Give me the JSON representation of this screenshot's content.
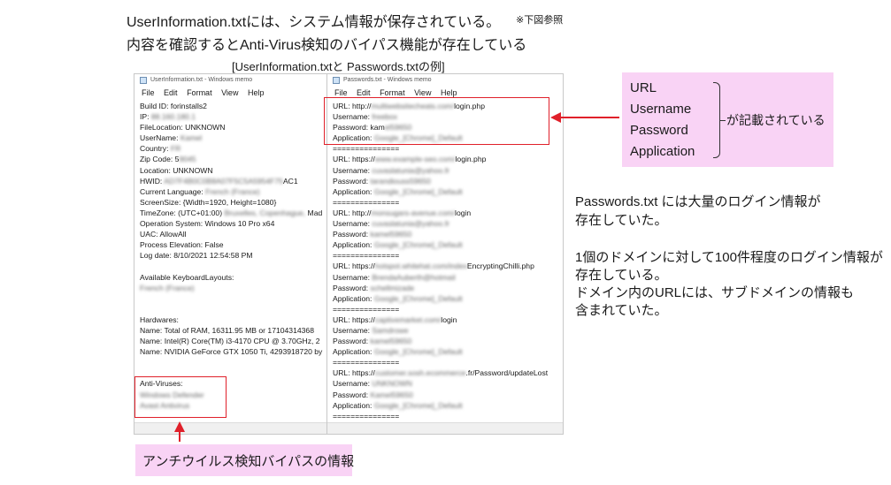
{
  "header": {
    "line1": "UserInformation.txtには、システム情報が保存されている。",
    "line2": "内容を確認するとAnti-Virus検知のバイパス機能が存在している",
    "ref_note": "※下図参照",
    "example_caption": "[UserInformation.txtと Passwords.txtの例]"
  },
  "notepad_left": {
    "title": "UserInformation.txt - Windows memo",
    "menu": [
      "File",
      "Edit",
      "Format",
      "View",
      "Help"
    ],
    "lines": [
      {
        "text": "Build ID: forinstalls2"
      },
      {
        "text": "IP: ",
        "blurred": "88.160.180.1"
      },
      {
        "text": "FileLocation: UNKNOWN"
      },
      {
        "text": "UserName: ",
        "blurred": "Kamel"
      },
      {
        "text": "Country: ",
        "blurred": "FR"
      },
      {
        "text": "Zip Code: 5",
        "blurred": "9045"
      },
      {
        "text": "Location: UNKNOWN"
      },
      {
        "text": "HWID: ",
        "blurred": "AD7F4B0C0B8A07F5C5A5954F75",
        "suffix": "AC1"
      },
      {
        "text": "Current Language: ",
        "blurred": "French (France)"
      },
      {
        "text": "ScreenSize: {Width=1920, Height=1080}"
      },
      {
        "text": "TimeZone: (UTC+01:00) ",
        "blurred": "Bruxelles, Copenhague,",
        "suffix": " Mad"
      },
      {
        "text": "Operation System: Windows 10 Pro x64"
      },
      {
        "text": "UAC: AllowAll"
      },
      {
        "text": "Process Elevation: False"
      },
      {
        "text": "Log date: 8/10/2021 12:54:58 PM"
      },
      {
        "text": ""
      },
      {
        "text": "Available KeyboardLayouts:"
      },
      {
        "text": "",
        "blurred": "French (France)"
      },
      {
        "text": ""
      },
      {
        "text": ""
      },
      {
        "text": "Hardwares:"
      },
      {
        "text": "Name: Total of RAM, 16311.95 MB or 17104314368"
      },
      {
        "text": "Name: Intel(R) Core(TM) i3-4170 CPU @ 3.70GHz, 2"
      },
      {
        "text": "Name: NVIDIA GeForce GTX 1050 Ti, 4293918720 by"
      },
      {
        "text": ""
      },
      {
        "text": ""
      },
      {
        "text": "Anti-Viruses:"
      },
      {
        "text": "",
        "blurred": "Windows Defender"
      },
      {
        "text": "",
        "blurred": "Avast Antivirus"
      }
    ]
  },
  "notepad_right": {
    "title": "Passwords.txt - Windows memo",
    "menu": [
      "File",
      "Edit",
      "Format",
      "View",
      "Help"
    ],
    "lines": [
      {
        "text": "URL: http://",
        "blurred": "multiwebsitecheats.com/",
        "suffix": "login.php"
      },
      {
        "text": "Username: ",
        "blurred": "freebox"
      },
      {
        "text": "Password: kam",
        "blurred": "el59650"
      },
      {
        "text": "Application: ",
        "blurred": "Google_[Chrome]_Default"
      },
      {
        "text": "==============="
      },
      {
        "text": "URL: https://",
        "blurred": "www.example-seo.com/",
        "suffix": "login.php"
      },
      {
        "text": "Username: ",
        "blurred": "cuvaslatunia@yahoo.fr"
      },
      {
        "text": "Password: ",
        "blurred": "tarandiouss59650"
      },
      {
        "text": "Application: ",
        "blurred": "Google_[Chrome]_Default"
      },
      {
        "text": "==============="
      },
      {
        "text": "URL: http://",
        "blurred": "monsugars-avenue.com/",
        "suffix": "login"
      },
      {
        "text": "Username: ",
        "blurred": "cuvaslatunia@yahoo.fr"
      },
      {
        "text": "Password: ",
        "blurred": "kamel59650"
      },
      {
        "text": "Application: ",
        "blurred": "Google_[Chrome]_Default"
      },
      {
        "text": "==============="
      },
      {
        "text": "URL: https://",
        "blurred": "hotspot.whitehat.com/index",
        "suffix": "EncryptingChilli.php"
      },
      {
        "text": "Username: ",
        "blurred": "BrendaAuberth@hotmail"
      },
      {
        "text": "Password: ",
        "blurred": "schellmizade"
      },
      {
        "text": "Application: ",
        "blurred": "Google_[Chrome]_Default"
      },
      {
        "text": "==============="
      },
      {
        "text": "URL: https://",
        "blurred": "captivemarket.com/",
        "suffix": "login"
      },
      {
        "text": "Username: ",
        "blurred": "Samdrowe"
      },
      {
        "text": "Password: ",
        "blurred": "kamel59650"
      },
      {
        "text": "Application: ",
        "blurred": "Google_[Chrome]_Default"
      },
      {
        "text": "==============="
      },
      {
        "text": "URL: https://",
        "blurred": "customer.sosh.ecommerce",
        "suffix": ".fr/Password/updateLost"
      },
      {
        "text": "Username: ",
        "blurred": "UNKNOWN"
      },
      {
        "text": "Password: ",
        "blurred": "Kamel59650"
      },
      {
        "text": "Application: ",
        "blurred": "Google_[Chrome]_Default"
      },
      {
        "text": "==============="
      }
    ]
  },
  "fields_callout": {
    "items": [
      "URL",
      "Username",
      "Password",
      "Application"
    ],
    "note": "が記載されている"
  },
  "av_callout": "アンチウイルス検知バイパスの情報",
  "right_note": {
    "para1": [
      "Passwords.txt  には大量のログイン情報が",
      "存在していた。"
    ],
    "para2": [
      "1個のドメインに対して100件程度のログイン情報が",
      "存在している。",
      "ドメイン内のURLには、サブドメインの情報も",
      "含まれていた。"
    ]
  },
  "colors": {
    "highlight_red": "#e0202a",
    "callout_pink": "#f9d3f5"
  }
}
